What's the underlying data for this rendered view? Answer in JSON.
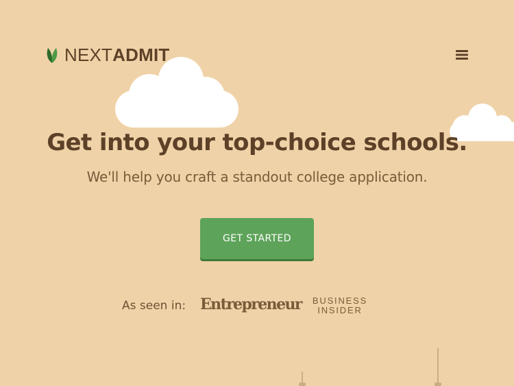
{
  "brand": {
    "name_light": "NEXT",
    "name_bold": "ADMIT",
    "leaf_color": "#3f7a3b"
  },
  "header": {
    "menu_icon": "hamburger-icon"
  },
  "hero": {
    "title": "Get into your top-choice schools.",
    "subtitle": "We'll help you craft a standout college application.",
    "cta_label": "GET STARTED",
    "cta_color": "#5ea35a"
  },
  "press": {
    "label": "As seen in:",
    "logos": {
      "entrepreneur": "Entrepreneur",
      "business_insider": [
        "BUSINESS",
        "INSIDER"
      ]
    }
  },
  "theme": {
    "background": "#f0d2a8",
    "text": "#5c4128",
    "cloud": "#ffffff"
  }
}
